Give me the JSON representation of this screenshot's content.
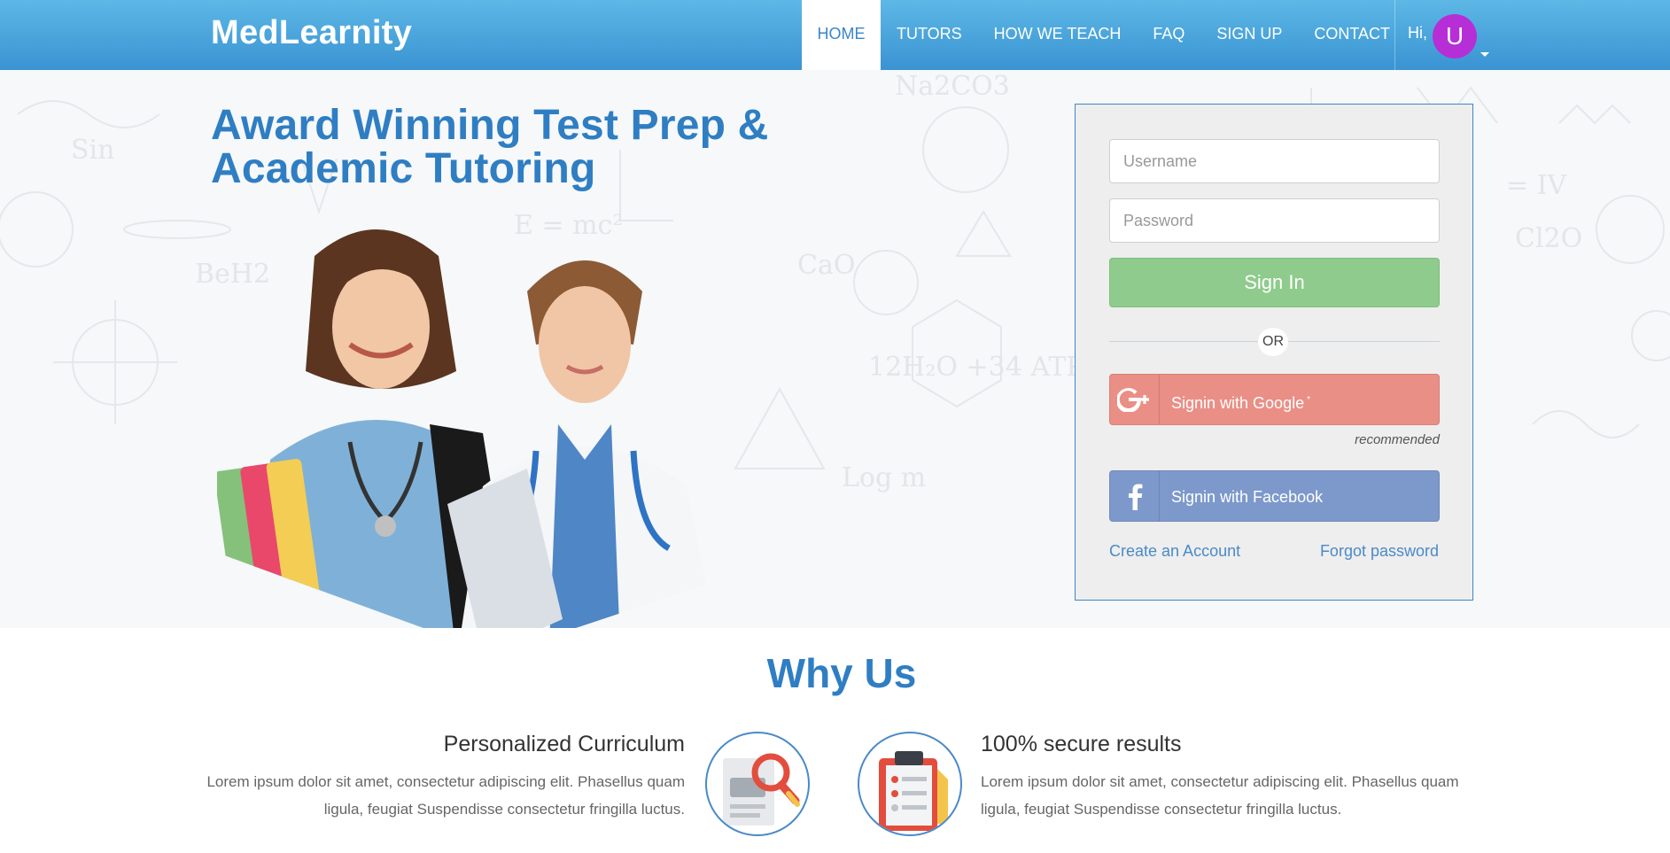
{
  "brand": "MedLearnity",
  "nav": {
    "items": [
      "HOME",
      "TUTORS",
      "HOW WE TEACH",
      "FAQ",
      "SIGN UP",
      "CONTACT"
    ],
    "active": "HOME",
    "greeting": "Hi,",
    "avatar_initial": "U"
  },
  "hero": {
    "title": "Award Winning Test Prep & Academic Tutoring"
  },
  "login": {
    "username_placeholder": "Username",
    "password_placeholder": "Password",
    "signin_label": "Sign In",
    "or_label": "OR",
    "google_label": "Signin with Google",
    "google_note": "*",
    "recommended": "recommended",
    "facebook_label": "Signin with Facebook",
    "create_account": "Create an Account",
    "forgot_password": "Forgot password"
  },
  "why_us": {
    "title": "Why Us",
    "features": [
      {
        "title": "Personalized Curriculum",
        "text": "Lorem ipsum dolor sit amet, consectetur adipiscing elit. Phasellus quam ligula, feugiat Suspendisse consectetur fringilla luctus."
      },
      {
        "title": "100% secure results",
        "text": "Lorem ipsum dolor sit amet, consectetur adipiscing elit. Phasellus quam ligula, feugiat Suspendisse consectetur fringilla luctus."
      }
    ]
  },
  "colors": {
    "nav_top": "#5db8e6",
    "nav_bottom": "#3a93d2",
    "heading_blue": "#2f7ec3",
    "signin_green": "#8fcb8c",
    "google_red": "#ea8f86",
    "facebook_blue": "#7d99cb",
    "avatar_purple": "#b62fd6"
  },
  "icons": {
    "google": "google-plus-icon",
    "facebook": "facebook-icon",
    "feature1": "magnifier-document-icon",
    "feature2": "clipboard-checklist-icon"
  }
}
